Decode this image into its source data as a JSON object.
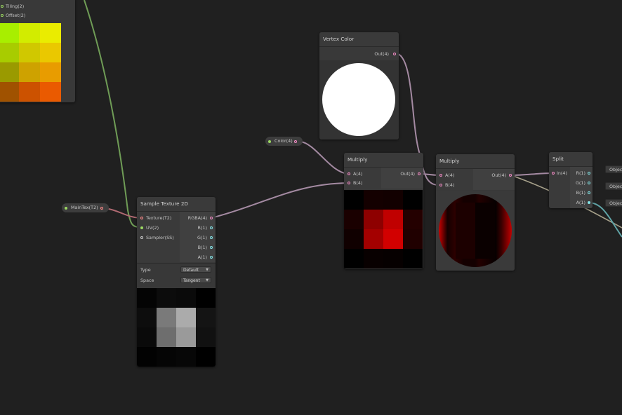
{
  "top_left_node": {
    "ports": [
      "Tiling(2)",
      "Offset(2)"
    ],
    "swatch_colors": [
      [
        "#55f000",
        "#a8ee00",
        "#d2ec00",
        "#eaec00"
      ],
      [
        "#44d000",
        "#a8cc00",
        "#d0c800",
        "#eac800"
      ],
      [
        "#3aa000",
        "#9a9a00",
        "#cea200",
        "#e89c00"
      ],
      [
        "#4e5a00",
        "#a05200",
        "#cc5200",
        "#ea5a00"
      ]
    ]
  },
  "maintex_property": {
    "label": "MainTex(T2)"
  },
  "color_property": {
    "label": "Color(4)"
  },
  "vertex_color_node": {
    "title": "Vertex Color",
    "output": "Out(4)"
  },
  "sample_texture_node": {
    "title": "Sample Texture 2D",
    "inputs": [
      "Texture(T2)",
      "UV(2)",
      "Sampler(SS)"
    ],
    "outputs": [
      "RGBA(4)",
      "R(1)",
      "G(1)",
      "B(1)",
      "A(1)"
    ],
    "type_label": "Type",
    "type_value": "Default",
    "space_label": "Space",
    "space_value": "Tangent",
    "preview_colors": [
      [
        "#040404",
        "#0c0c0c",
        "#0a0a0a",
        "#000000"
      ],
      [
        "#0d0d0d",
        "#7a7a7a",
        "#ababab",
        "#141414"
      ],
      [
        "#0a0a0a",
        "#6e6e6e",
        "#9a9a9a",
        "#111111"
      ],
      [
        "#020202",
        "#050505",
        "#070707",
        "#000000"
      ]
    ]
  },
  "multiply_node_1": {
    "title": "Multiply",
    "inputs": [
      "A(4)",
      "B(4)"
    ],
    "output": "Out(4)",
    "preview_colors": [
      [
        "#000000",
        "#140000",
        "#120000",
        "#000000"
      ],
      [
        "#1a0000",
        "#8e0000",
        "#c00000",
        "#240000"
      ],
      [
        "#100000",
        "#a40000",
        "#d20000",
        "#200000"
      ],
      [
        "#000000",
        "#080000",
        "#060000",
        "#000000"
      ]
    ]
  },
  "multiply_node_2": {
    "title": "Multiply",
    "inputs": [
      "A(4)",
      "B(4)"
    ],
    "output": "Out(4)"
  },
  "split_node": {
    "title": "Split",
    "input": "In(4)",
    "outputs": [
      "R(1)",
      "G(1)",
      "B(1)",
      "A(1)"
    ]
  },
  "object_chips": [
    "Object",
    "Object",
    "Object"
  ],
  "colors": {
    "background": "#202020",
    "node": "#393939",
    "vector4_port": "#f28ac4",
    "vector2_port": "#9bd862",
    "vector1_port": "#84e4e7",
    "texture_port": "#ff8b8b",
    "wire_vector4": "#a48aa2",
    "wire_uv": "#6f9c56",
    "wire_alpha": "#5fa3a6",
    "wire_texture": "#b06a72"
  }
}
